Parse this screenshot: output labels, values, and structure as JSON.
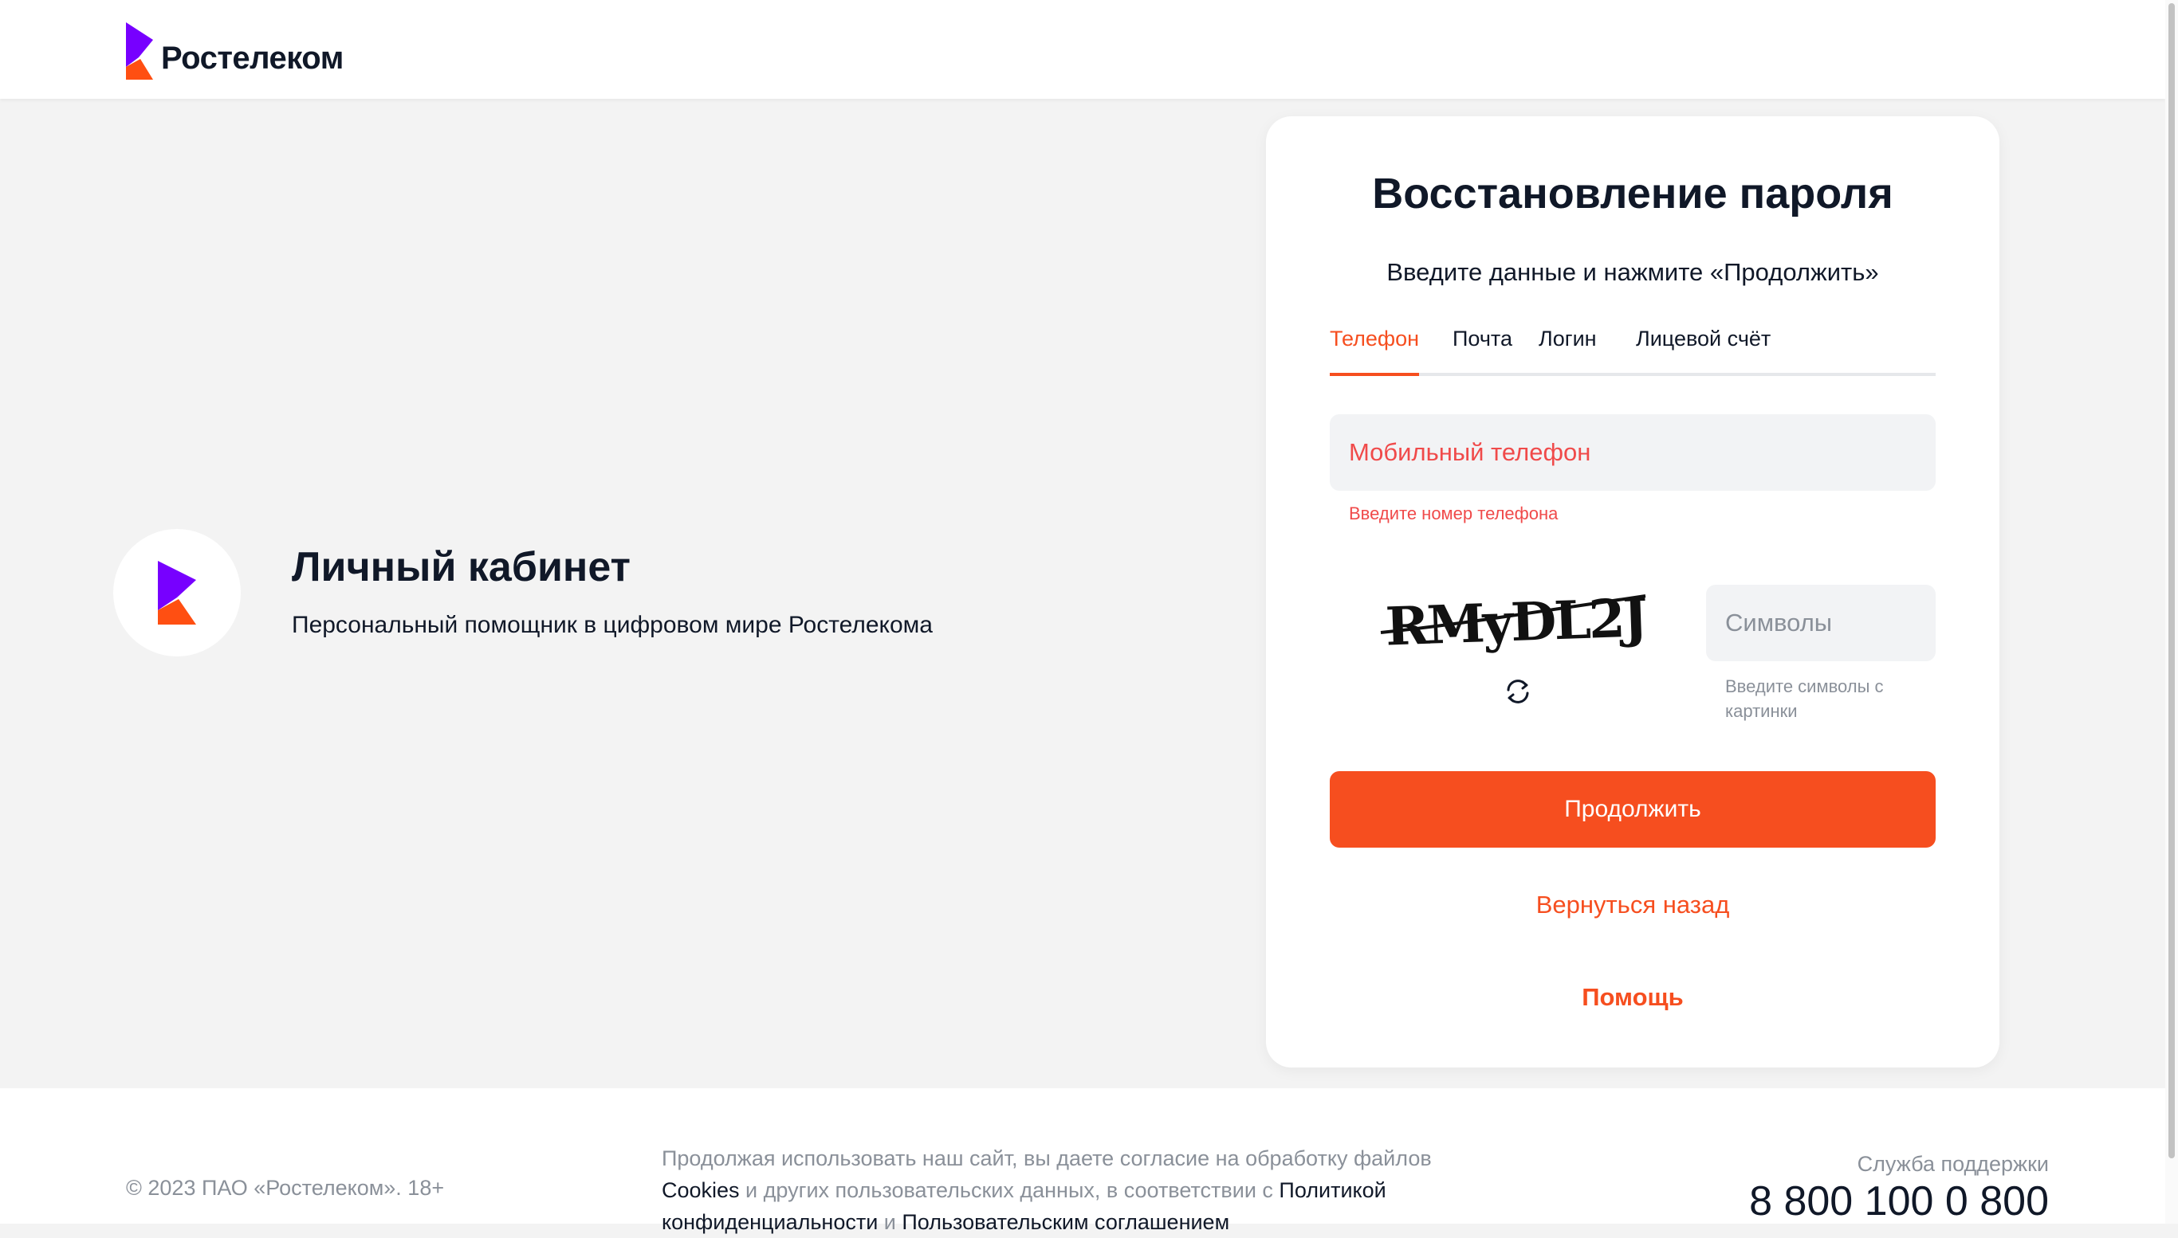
{
  "colors": {
    "accent": "#f64e1f",
    "brand_purple": "#7700ff",
    "error": "#f04a4a",
    "text": "#101828",
    "muted": "#8a9099",
    "background": "#f3f3f3",
    "field": "#f2f3f5"
  },
  "header": {
    "logo_text": "Ростелеком",
    "logo_icon": "rostelecom-logo-icon"
  },
  "promo": {
    "icon": "rostelecom-logo-icon",
    "title": "Личный кабинет",
    "subtitle": "Персональный помощник в цифровом мире Ростелекома"
  },
  "card": {
    "title": "Восстановление пароля",
    "subtitle": "Введите данные и нажмите «Продолжить»",
    "tabs": [
      {
        "label": "Телефон",
        "active": true
      },
      {
        "label": "Почта",
        "active": false
      },
      {
        "label": "Логин",
        "active": false
      },
      {
        "label": "Лицевой счёт",
        "active": false
      }
    ],
    "phone_field": {
      "placeholder": "Мобильный телефон",
      "value": "",
      "error": "Введите номер телефона"
    },
    "captcha": {
      "image_text": "RMyDL2J",
      "refresh_icon": "refresh-icon",
      "placeholder": "Символы",
      "hint": "Введите символы с картинки"
    },
    "continue_button": "Продолжить",
    "back_link": "Вернуться назад",
    "help_link": "Помощь"
  },
  "footer": {
    "copyright": "© 2023 ПАО «Ростелеком». 18+",
    "legal": {
      "part1": "Продолжая использовать наш сайт, вы даете согласие на обработку файлов ",
      "cookies_link": "Cookies",
      "part2": " и других пользовательских данных, в соответствии с ",
      "privacy_link": "Политикой конфиденциальности",
      "part3": " и ",
      "agreement_link": "Пользовательским соглашением"
    },
    "support_label": "Служба поддержки",
    "support_phone": "8 800 100 0 800"
  }
}
